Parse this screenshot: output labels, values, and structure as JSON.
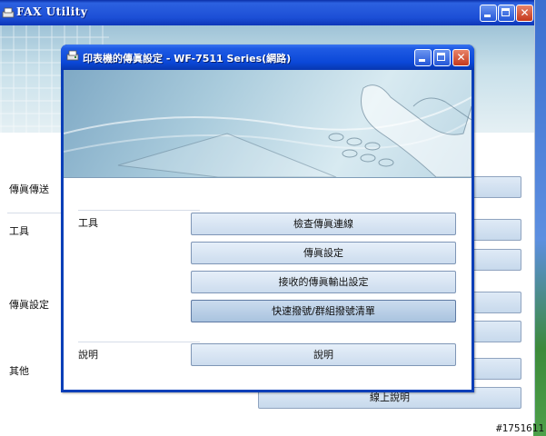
{
  "back_window": {
    "title": "FAX Utility",
    "sidebar": [
      "傳眞傳送",
      "工具",
      "傳眞設定",
      "其他"
    ],
    "buttons_visible": [
      "線上說明"
    ]
  },
  "dialog": {
    "title": "印表機的傳眞設定 - WF-7511 Series(網路)",
    "sections": [
      {
        "label": "工具",
        "buttons": [
          "檢查傳眞連線",
          "傳眞設定",
          "接收的傳眞輸出設定",
          "快速撥號/群組撥號清單"
        ]
      },
      {
        "label": "說明",
        "buttons": [
          "說明"
        ]
      }
    ],
    "focused_button": "快速撥號/群組撥號清單"
  },
  "watermark": "#1751611",
  "colors": {
    "titlebar": "#1c4fd6",
    "close": "#c4391c",
    "button": "#ccdcee"
  }
}
